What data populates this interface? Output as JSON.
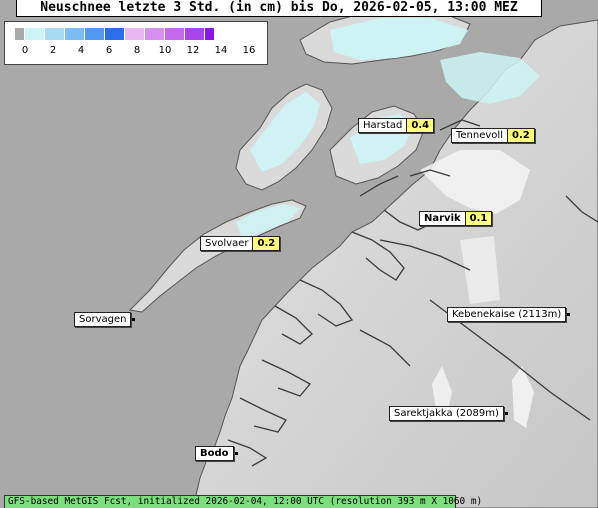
{
  "title": "Neuschnee letzte 3 Std. (in cm) bis Do, 2026-02-05, 13:00 MEZ",
  "legend": {
    "colors": [
      "#a9a9a9",
      "#cdf4f6",
      "#a8dcf5",
      "#7cbcf2",
      "#4f9aee",
      "#2a6ee8",
      "#e8b8f2",
      "#d690f0",
      "#c468ee",
      "#a844ea",
      "#8a18e2"
    ],
    "ticks": [
      "0",
      "2",
      "4",
      "6",
      "8",
      "10",
      "12",
      "14",
      "16"
    ]
  },
  "places": [
    {
      "name": "Harstad",
      "value": "0.4"
    },
    {
      "name": "Tennevoll",
      "value": "0.2"
    },
    {
      "name": "Narvik",
      "value": "0.1"
    },
    {
      "name": "Svolvaer",
      "value": "0.2"
    },
    {
      "name": "Sorvagen"
    },
    {
      "name": "Kebenekaise (2113m)"
    },
    {
      "name": "Sarektjakka (2089m)"
    },
    {
      "name": "Bodo"
    }
  ],
  "footer": "GFS-based MetGIS Fcst, initialized 2026-02-04, 12:00 UTC  (resolution 393 m X 1060 m)",
  "colors": {
    "sea": "#a9a9a9",
    "land": "#d9d9d9",
    "snow": "#cdf4f6",
    "value_box": "#ffff80",
    "footer": "#7dde7d"
  }
}
